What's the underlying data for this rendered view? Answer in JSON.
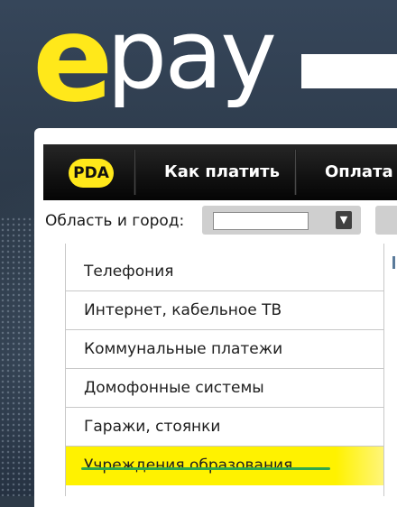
{
  "brand": {
    "logo_e": "e",
    "logo_rest": "pay",
    "accent_color": "#ffe81a"
  },
  "nav": {
    "items": [
      {
        "label": "PDA"
      },
      {
        "label": "Как платить"
      },
      {
        "label": "Оплата у"
      }
    ]
  },
  "region": {
    "label": "Область и город:",
    "value": "",
    "dropdown_icon": "chevron-down-icon"
  },
  "categories": {
    "items": [
      {
        "label": "Телефония"
      },
      {
        "label": "Интернет, кабельное ТВ"
      },
      {
        "label": "Коммунальные платежи"
      },
      {
        "label": "Домофонные системы"
      },
      {
        "label": "Гаражи, стоянки"
      },
      {
        "label": "Учреждения образования"
      }
    ],
    "highlight_color": "#fff200"
  }
}
